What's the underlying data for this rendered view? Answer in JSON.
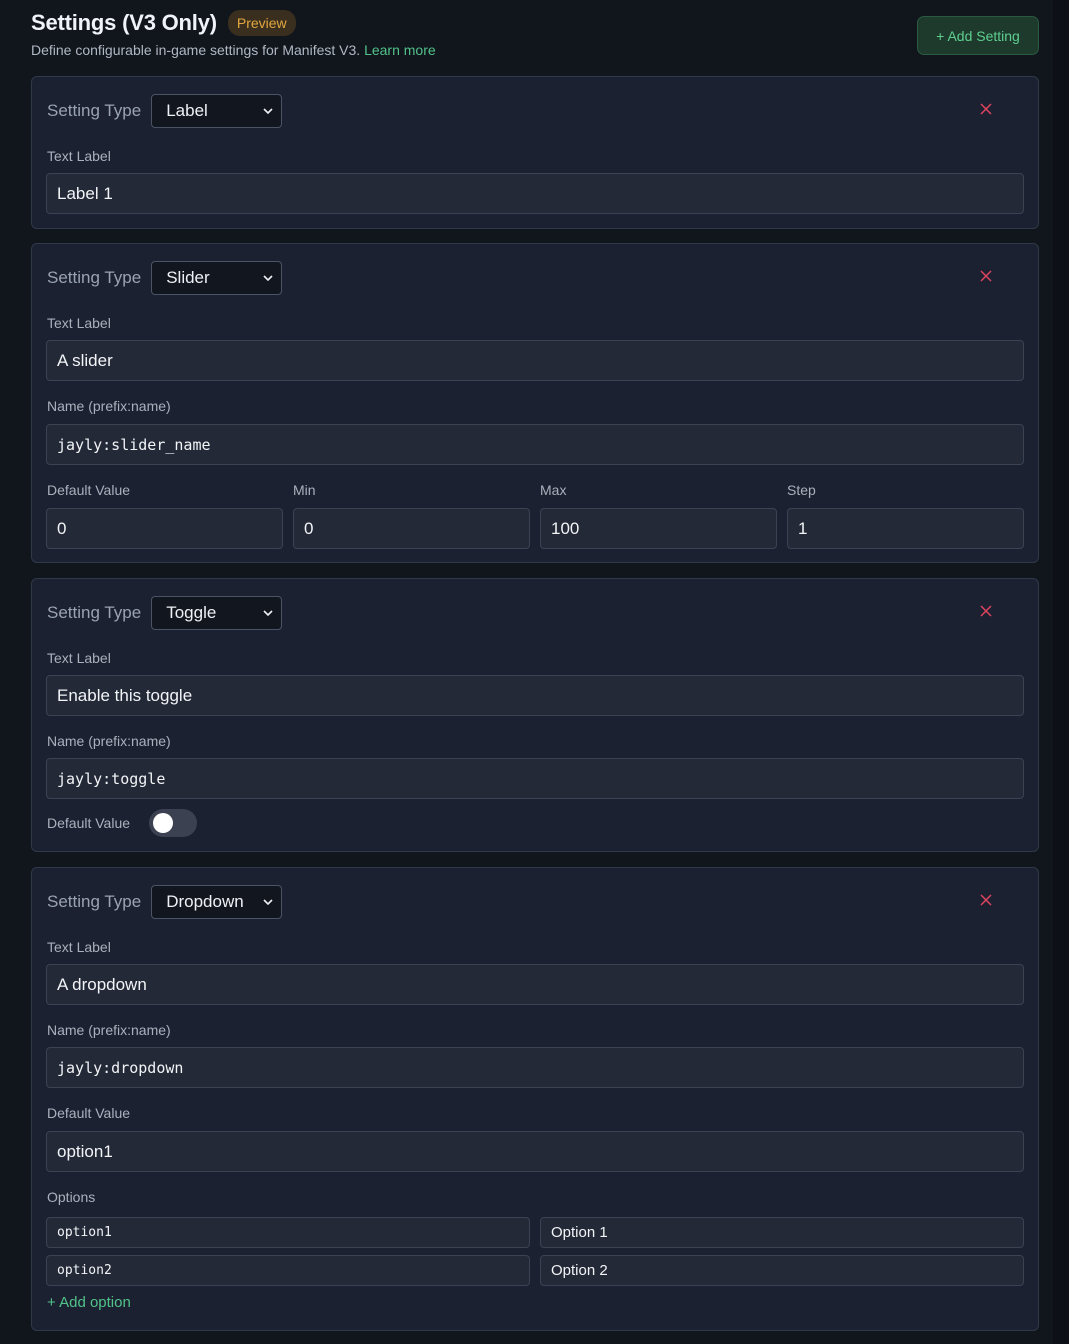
{
  "header": {
    "title": "Settings (V3 Only)",
    "badge": "Preview",
    "subtitle": "Define configurable in-game settings for Manifest V3.",
    "learn_more": "Learn more",
    "add_setting": "+ Add Setting"
  },
  "common": {
    "setting_type_label": "Setting Type",
    "text_label": "Text Label",
    "name_label": "Name (prefix:name)",
    "default_value_label": "Default Value"
  },
  "cards": {
    "label": {
      "type": "Label",
      "text_label": "Label 1"
    },
    "slider": {
      "type": "Slider",
      "text_label": "A slider",
      "name": "jayly:slider_name",
      "min_label": "Min",
      "max_label": "Max",
      "step_label": "Step",
      "default_value": "0",
      "min": "0",
      "max": "100",
      "step": "1"
    },
    "toggle": {
      "type": "Toggle",
      "text_label": "Enable this toggle",
      "name": "jayly:toggle",
      "default_on": false
    },
    "dropdown": {
      "type": "Dropdown",
      "text_label": "A dropdown",
      "name": "jayly:dropdown",
      "default_value": "option1",
      "options_label": "Options",
      "options": [
        {
          "value": "option1",
          "label": "Option 1"
        },
        {
          "value": "option2",
          "label": "Option 2"
        }
      ],
      "add_option": "+ Add option"
    }
  },
  "colors": {
    "accent_green": "#52c28a",
    "badge_orange": "#e2a63f",
    "remove_red": "#e0445f",
    "card_bg": "#1b2130"
  },
  "icons": {
    "remove": "close-icon",
    "select_arrow": "chevron-down-icon"
  }
}
